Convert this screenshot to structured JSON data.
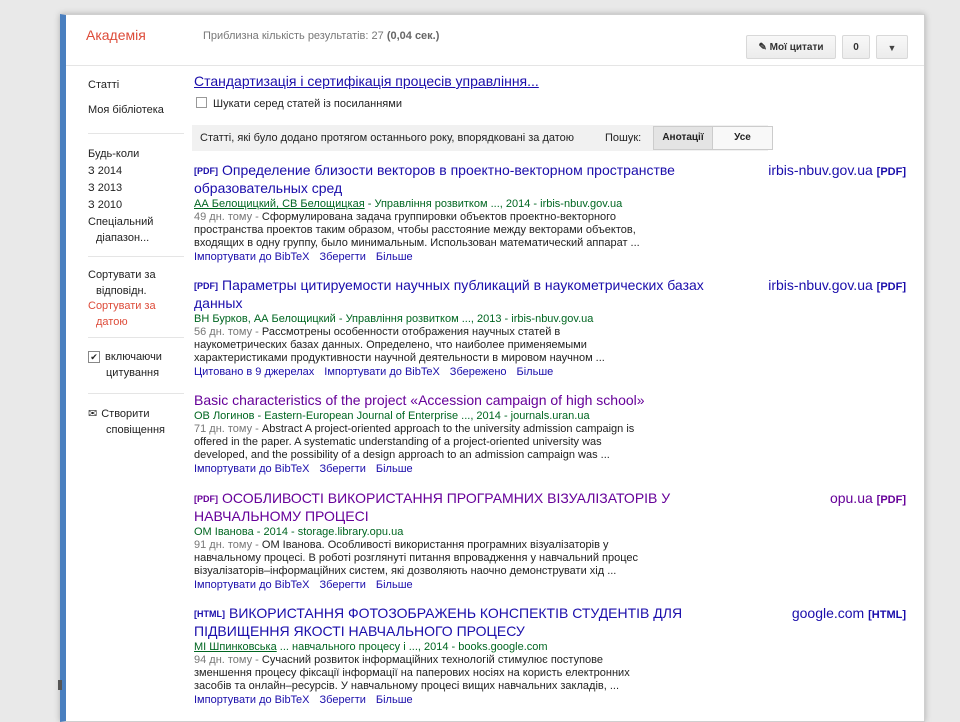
{
  "header": {
    "logo": "Академія",
    "results_count": "Приблизна кількість результатів: 27",
    "results_time": "(0,04 сек.)",
    "my_citations_label": "Мої цитати",
    "notifications_count": "0"
  },
  "sidebar": {
    "articles": "Статті",
    "my_library": "Моя бібліотека",
    "any_time": "Будь-коли",
    "since_2014": "З 2014",
    "since_2013": "З 2013",
    "since_2010": "З 2010",
    "custom_range_1": "Спеціальний",
    "custom_range_2": "діапазон...",
    "sort_relevance_1": "Сортувати за",
    "sort_relevance_2": "відповідн.",
    "sort_date_1": "Сортувати за",
    "sort_date_2": "датою",
    "include_citations_1": "включаючи",
    "include_citations_2": "цитування",
    "create_alert_1": "Створити",
    "create_alert_2": "сповіщення"
  },
  "query": {
    "title_link": "Стандартизація і сертифікація процесів управління...",
    "search_citing": "Шукати серед статей із посиланнями"
  },
  "filter": {
    "text": "Статті, які було додано протягом останнього року, впорядковані за датою",
    "search_label": "Пошук:",
    "annotations": "Анотації",
    "all": "Усе"
  },
  "results": [
    {
      "tag": "[PDF]",
      "title": "Определение близости векторов в проектно-векторном пространстве образовательных сред",
      "source": "irbis-nbuv.gov.ua",
      "source_tag": "[PDF]",
      "authors": "АА Белощицкий, СВ Белощицкая",
      "venue": "- Управління розвитком ..., 2014 - irbis-nbuv.gov.ua",
      "age": "49 дн. тому -",
      "snippet": "Сформулирована задача группировки объектов проектно-векторного пространства проектов таким образом, чтобы расстояние между векторами объектов, входящих в одну группу, было минимальным. Использован математический аппарат ...",
      "actions": [
        "Імпортувати до BibTeX",
        "Зберегти",
        "Більше"
      ]
    },
    {
      "tag": "[PDF]",
      "title": "Параметры цитируемости научных публикаций в наукометрических базах данных",
      "source": "irbis-nbuv.gov.ua",
      "source_tag": "[PDF]",
      "authors": "ВН Бурков, АА Белощицкий",
      "venue": "- Управління розвитком ..., 2013 - irbis-nbuv.gov.ua",
      "age": "56 дн. тому -",
      "snippet": "Рассмотрены особенности отображения научных статей в наукометрических базах данных. Определено, что наиболее применяемыми характеристиками продуктивности научной деятельности в мировом научном ...",
      "actions": [
        "Цитовано в 9 джерелах",
        "Імпортувати до BibTeX",
        "Збережено",
        "Більше"
      ]
    },
    {
      "tag": "",
      "title": "Basic characteristics of the project «Accession campaign of high school»",
      "source": "",
      "source_tag": "",
      "authors": "ОВ Логинов",
      "venue": "- Eastern-European Journal of Enterprise ..., 2014 - journals.uran.ua",
      "age": "71 дн. тому -",
      "snippet": "Abstract A project-oriented approach to the university admission campaign is offered in the paper. A systematic understanding of a project-oriented university was developed, and the possibility of a design approach to an admission campaign was ...",
      "actions": [
        "Імпортувати до BibTeX",
        "Зберегти",
        "Більше"
      ]
    },
    {
      "tag": "[PDF]",
      "title": "ОСОБЛИВОСТІ ВИКОРИСТАННЯ ПРОГРАМНИХ ВІЗУАЛІЗАТОРІВ У НАВЧАЛЬНОМУ ПРОЦЕСІ",
      "source": "opu.ua",
      "source_tag": "[PDF]",
      "authors": "ОМ Іванова",
      "venue": "- 2014 - storage.library.opu.ua",
      "age": "91 дн. тому -",
      "snippet": "ОМ Іванова. Особливості використання програмних візуалізаторів у навчальному процесі. В роботі розглянуті питання впровадження у навчальний процес візуалізаторів–інформаційних систем, які дозволяють наочно демонструвати хід ...",
      "actions": [
        "Імпортувати до BibTeX",
        "Зберегти",
        "Більше"
      ]
    },
    {
      "tag": "[HTML]",
      "title": "ВИКОРИСТАННЯ ФОТОЗОБРАЖЕНЬ КОНСПЕКТІВ СТУДЕНТІВ ДЛЯ ПІДВИЩЕННЯ ЯКОСТІ НАВЧАЛЬНОГО ПРОЦЕСУ",
      "source": "google.com",
      "source_tag": "[HTML]",
      "authors": "МІ Шпинковська",
      "venue": "... навчального процесу і ..., 2014 - books.google.com",
      "age": "94 дн. тому -",
      "snippet": "Сучасний розвиток інформаційних технологій стимулює поступове зменшення процесу фіксації інформації на паперових носіях на користь електронних засобів та онлайн–ресурсів. У навчальному процесі вищих навчальних закладів, ...",
      "actions": [
        "Імпортувати до BibTeX",
        "Зберегти",
        "Більше"
      ]
    }
  ]
}
